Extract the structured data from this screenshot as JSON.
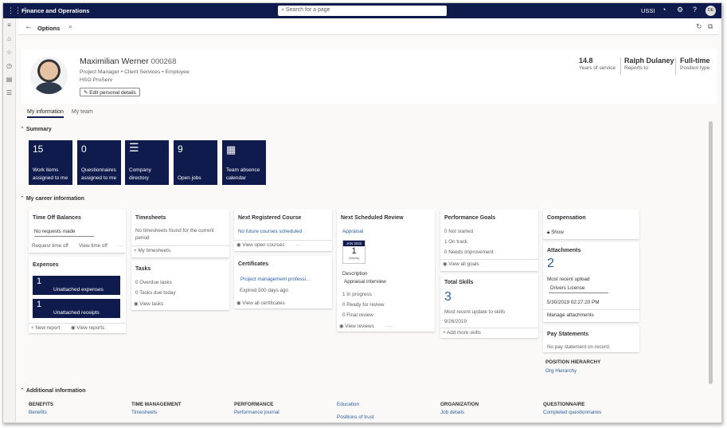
{
  "topbar": {
    "app_name": "Finance and Operations",
    "search_placeholder": "Search for a page",
    "company": "USSI",
    "avatar": "DE"
  },
  "actionbar": {
    "title": "Options"
  },
  "profile": {
    "name": "Maximilian Werner",
    "id": "000268",
    "meta": "Project Manager  •  Client Services  •  Employee",
    "org": "HSO ProServ",
    "edit_label": "Edit personal details",
    "stats": [
      {
        "value": "14.8",
        "label": "Years of service"
      },
      {
        "value": "Ralph Dulaney",
        "label": "Reports to"
      },
      {
        "value": "Full-time",
        "label": "Position type"
      }
    ]
  },
  "tabs": [
    "My information",
    "My team"
  ],
  "sections": {
    "summary": "Summary",
    "career": "My career information",
    "additional": "Additional information"
  },
  "tiles": [
    {
      "num": "15",
      "label": "Work items assigned to me"
    },
    {
      "num": "0",
      "label": "Questionnaires assigned to me"
    },
    {
      "num": "",
      "label": "Company directory"
    },
    {
      "num": "9",
      "label": "Open jobs"
    },
    {
      "num": "",
      "label": "Team absence calendar"
    }
  ],
  "timeoff": {
    "title": "Time Off Balances",
    "empty": "No requests made",
    "request": "Request time off",
    "view": "View time off",
    "more": "···"
  },
  "expenses": {
    "title": "Expenses",
    "unattached_expenses_num": "1",
    "unattached_expenses": "Unattached expenses",
    "unattached_receipts_num": "1",
    "unattached_receipts": "Unattached receipts",
    "new_report": "New report",
    "view_reports": "View reports"
  },
  "timesheets": {
    "title": "Timesheets",
    "empty1": "No timesheets found for the current",
    "empty2": "period",
    "link": "My timesheets"
  },
  "tasks": {
    "title": "Tasks",
    "overdue": "0 Overdue tasks",
    "due_today": "0 Tasks due today",
    "link": "View tasks"
  },
  "course": {
    "title": "Next Registered Course",
    "none": "No future courses scheduled",
    "link": "View open courses",
    "more": "···"
  },
  "certificates": {
    "title": "Certificates",
    "item": "Project management professi...",
    "expired": "Expired 500 days ago",
    "link": "View all certificates"
  },
  "review": {
    "title": "Next Scheduled Review",
    "type": "Appraisal",
    "cal_month": "JAN 2022",
    "cal_day": "1",
    "cal_weekday": "Saturday",
    "desc_label": "Description",
    "desc": "Appraisal interview",
    "in_progress": "1 In progress",
    "ready": "0 Ready for review",
    "final": "0 Final review",
    "link": "View reviews",
    "more": "···"
  },
  "goals": {
    "title": "Performance Goals",
    "not_started": "0 Not started",
    "on_track": "1 On track",
    "needs": "0 Needs improvement",
    "link": "View all goals"
  },
  "skills": {
    "title": "Total Skills",
    "count": "3",
    "recent_label": "Most recent update to skills",
    "recent_date": "9/26/2019",
    "link": "Add more skills"
  },
  "compensation": {
    "title": "Compensation",
    "show": "Show"
  },
  "attachments": {
    "title": "Attachments",
    "count": "2",
    "recent_label": "Most recent upload",
    "file": "Drivers License",
    "date": "5/30/2019 02:27:20 PM",
    "link": "Manage attachments"
  },
  "paystatements": {
    "title": "Pay Statements",
    "empty": "No pay statement on record."
  },
  "position": {
    "title": "POSITION HIERARCHY",
    "link": "Org Hierarchy"
  },
  "additional": [
    {
      "head": "BENEFITS",
      "links": [
        "Benefits"
      ]
    },
    {
      "head": "TIME MANAGEMENT",
      "links": [
        "Timesheets"
      ]
    },
    {
      "head": "PERFORMANCE",
      "links": [
        "Performance journal"
      ]
    },
    {
      "head": "",
      "links": [
        "Education",
        "Positions of trust"
      ]
    },
    {
      "head": "ORGANIZATION",
      "links": [
        "Job details"
      ]
    },
    {
      "head": "QUESTIONNAIRE",
      "links": [
        "Completed questionnaires"
      ]
    }
  ]
}
